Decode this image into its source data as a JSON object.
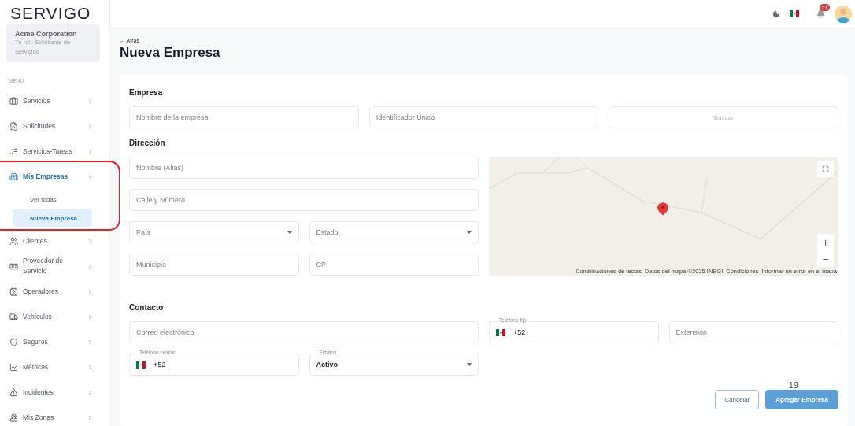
{
  "sidebar": {
    "logo": "SERVIGO",
    "company": {
      "name": "Acme Corporation",
      "role": "Tu rol : Solicitante de Servicios"
    },
    "menu_label": "MENÚ",
    "items": [
      {
        "label": "Servicios",
        "selected": false,
        "expanded": false
      },
      {
        "label": "Solicitudes",
        "selected": false,
        "expanded": false
      },
      {
        "label": "Servicios-Tareas",
        "selected": false,
        "expanded": false
      },
      {
        "label": "Mis Empresas",
        "selected": true,
        "expanded": true,
        "annotated": true,
        "children": [
          {
            "label": "Ver todas",
            "selected": false
          },
          {
            "label": "Nueva Empresa",
            "selected": true
          }
        ]
      },
      {
        "label": "Clientes",
        "selected": false,
        "expanded": false
      },
      {
        "label": "Proveedor de Servicio",
        "selected": false,
        "expanded": false
      },
      {
        "label": "Operadores",
        "selected": false,
        "expanded": false
      },
      {
        "label": "Vehículos",
        "selected": false,
        "expanded": false
      },
      {
        "label": "Seguros",
        "selected": false,
        "expanded": false
      },
      {
        "label": "Métricas",
        "selected": false,
        "expanded": false
      },
      {
        "label": "Incidentes",
        "selected": false,
        "expanded": false
      },
      {
        "label": "Mis Zonas",
        "selected": false,
        "expanded": false
      }
    ]
  },
  "topbar": {
    "notification_count": "51"
  },
  "page": {
    "back": "← Atrás",
    "title": "Nueva Empresa"
  },
  "sections": [
    {
      "title": "Empresa",
      "fields": [
        {
          "kind": "text",
          "placeholder": "Nombre de la empresa"
        },
        {
          "kind": "text",
          "placeholder": "Identificador Único"
        },
        {
          "kind": "button",
          "label": "Buscar",
          "disabled": true
        }
      ]
    },
    {
      "title": "Dirección",
      "fields": [
        {
          "kind": "text",
          "placeholder": "Nombre (Alias)"
        },
        {
          "kind": "text",
          "placeholder": "Calle y Número"
        },
        {
          "kind": "select",
          "placeholder": "País"
        },
        {
          "kind": "select",
          "placeholder": "Estado"
        },
        {
          "kind": "text",
          "placeholder": "Municipio"
        },
        {
          "kind": "text",
          "placeholder": "CP"
        }
      ],
      "map": {
        "attributions": [
          "Combinaciones de teclas",
          "Datos del mapa ©2025 INEGI",
          "Condiciones",
          "Informar un error en el mapa"
        ],
        "zoom_in": "+",
        "zoom_out": "−"
      }
    },
    {
      "title": "Contacto",
      "fields": [
        {
          "kind": "text",
          "placeholder": "Correo electrónico"
        },
        {
          "kind": "phone",
          "label": "Teléfono fijo",
          "value": "+52"
        },
        {
          "kind": "text",
          "placeholder": "Extensión"
        },
        {
          "kind": "phone",
          "label": "Teléfono celular",
          "value": "+52"
        },
        {
          "kind": "select",
          "label": "Estatus",
          "value": "Activo"
        }
      ]
    }
  ],
  "actions": [
    {
      "kind": "secondary",
      "label": "Cancelar"
    },
    {
      "kind": "primary",
      "label": "Agregar Empresa"
    }
  ],
  "page_number": "19"
}
